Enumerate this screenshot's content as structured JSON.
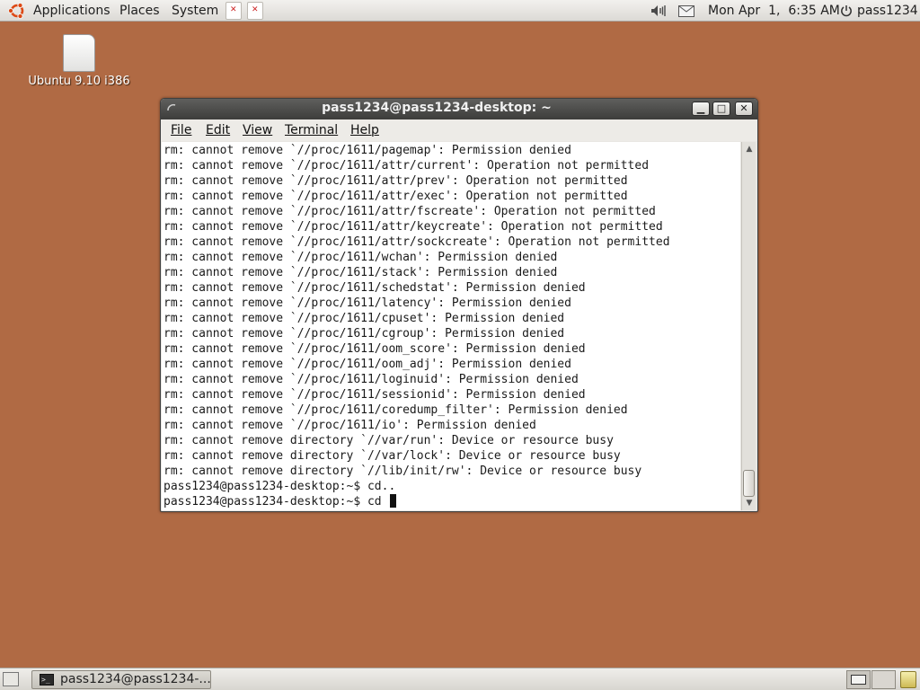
{
  "top_panel": {
    "applications": "Applications",
    "places": "Places",
    "system": "System",
    "clock": "Mon Apr  1,  6:35 AM",
    "user": "pass1234"
  },
  "desktop": {
    "icon_label": "Ubuntu 9.10 i386"
  },
  "window": {
    "title": "pass1234@pass1234-desktop: ~",
    "minimize_glyph": "▁",
    "maximize_glyph": "□",
    "close_glyph": "✕",
    "menus": [
      "File",
      "Edit",
      "View",
      "Terminal",
      "Help"
    ],
    "terminal_lines": [
      "rm: cannot remove `//proc/1611/pagemap': Permission denied",
      "rm: cannot remove `//proc/1611/attr/current': Operation not permitted",
      "rm: cannot remove `//proc/1611/attr/prev': Operation not permitted",
      "rm: cannot remove `//proc/1611/attr/exec': Operation not permitted",
      "rm: cannot remove `//proc/1611/attr/fscreate': Operation not permitted",
      "rm: cannot remove `//proc/1611/attr/keycreate': Operation not permitted",
      "rm: cannot remove `//proc/1611/attr/sockcreate': Operation not permitted",
      "rm: cannot remove `//proc/1611/wchan': Permission denied",
      "rm: cannot remove `//proc/1611/stack': Permission denied",
      "rm: cannot remove `//proc/1611/schedstat': Permission denied",
      "rm: cannot remove `//proc/1611/latency': Permission denied",
      "rm: cannot remove `//proc/1611/cpuset': Permission denied",
      "rm: cannot remove `//proc/1611/cgroup': Permission denied",
      "rm: cannot remove `//proc/1611/oom_score': Permission denied",
      "rm: cannot remove `//proc/1611/oom_adj': Permission denied",
      "rm: cannot remove `//proc/1611/loginuid': Permission denied",
      "rm: cannot remove `//proc/1611/sessionid': Permission denied",
      "rm: cannot remove `//proc/1611/coredump_filter': Permission denied",
      "rm: cannot remove `//proc/1611/io': Permission denied",
      "rm: cannot remove directory `//var/run': Device or resource busy",
      "rm: cannot remove directory `//var/lock': Device or resource busy",
      "rm: cannot remove directory `//lib/init/rw': Device or resource busy",
      "pass1234@pass1234-desktop:~$ cd.."
    ],
    "prompt_line": "pass1234@pass1234-desktop:~$ cd "
  },
  "bottom_panel": {
    "task_label": "pass1234@pass1234-..."
  },
  "colors": {
    "desktop_bg": "#b06a44",
    "titlebar": "#4a4a48",
    "panel": "#e4e2dd"
  }
}
